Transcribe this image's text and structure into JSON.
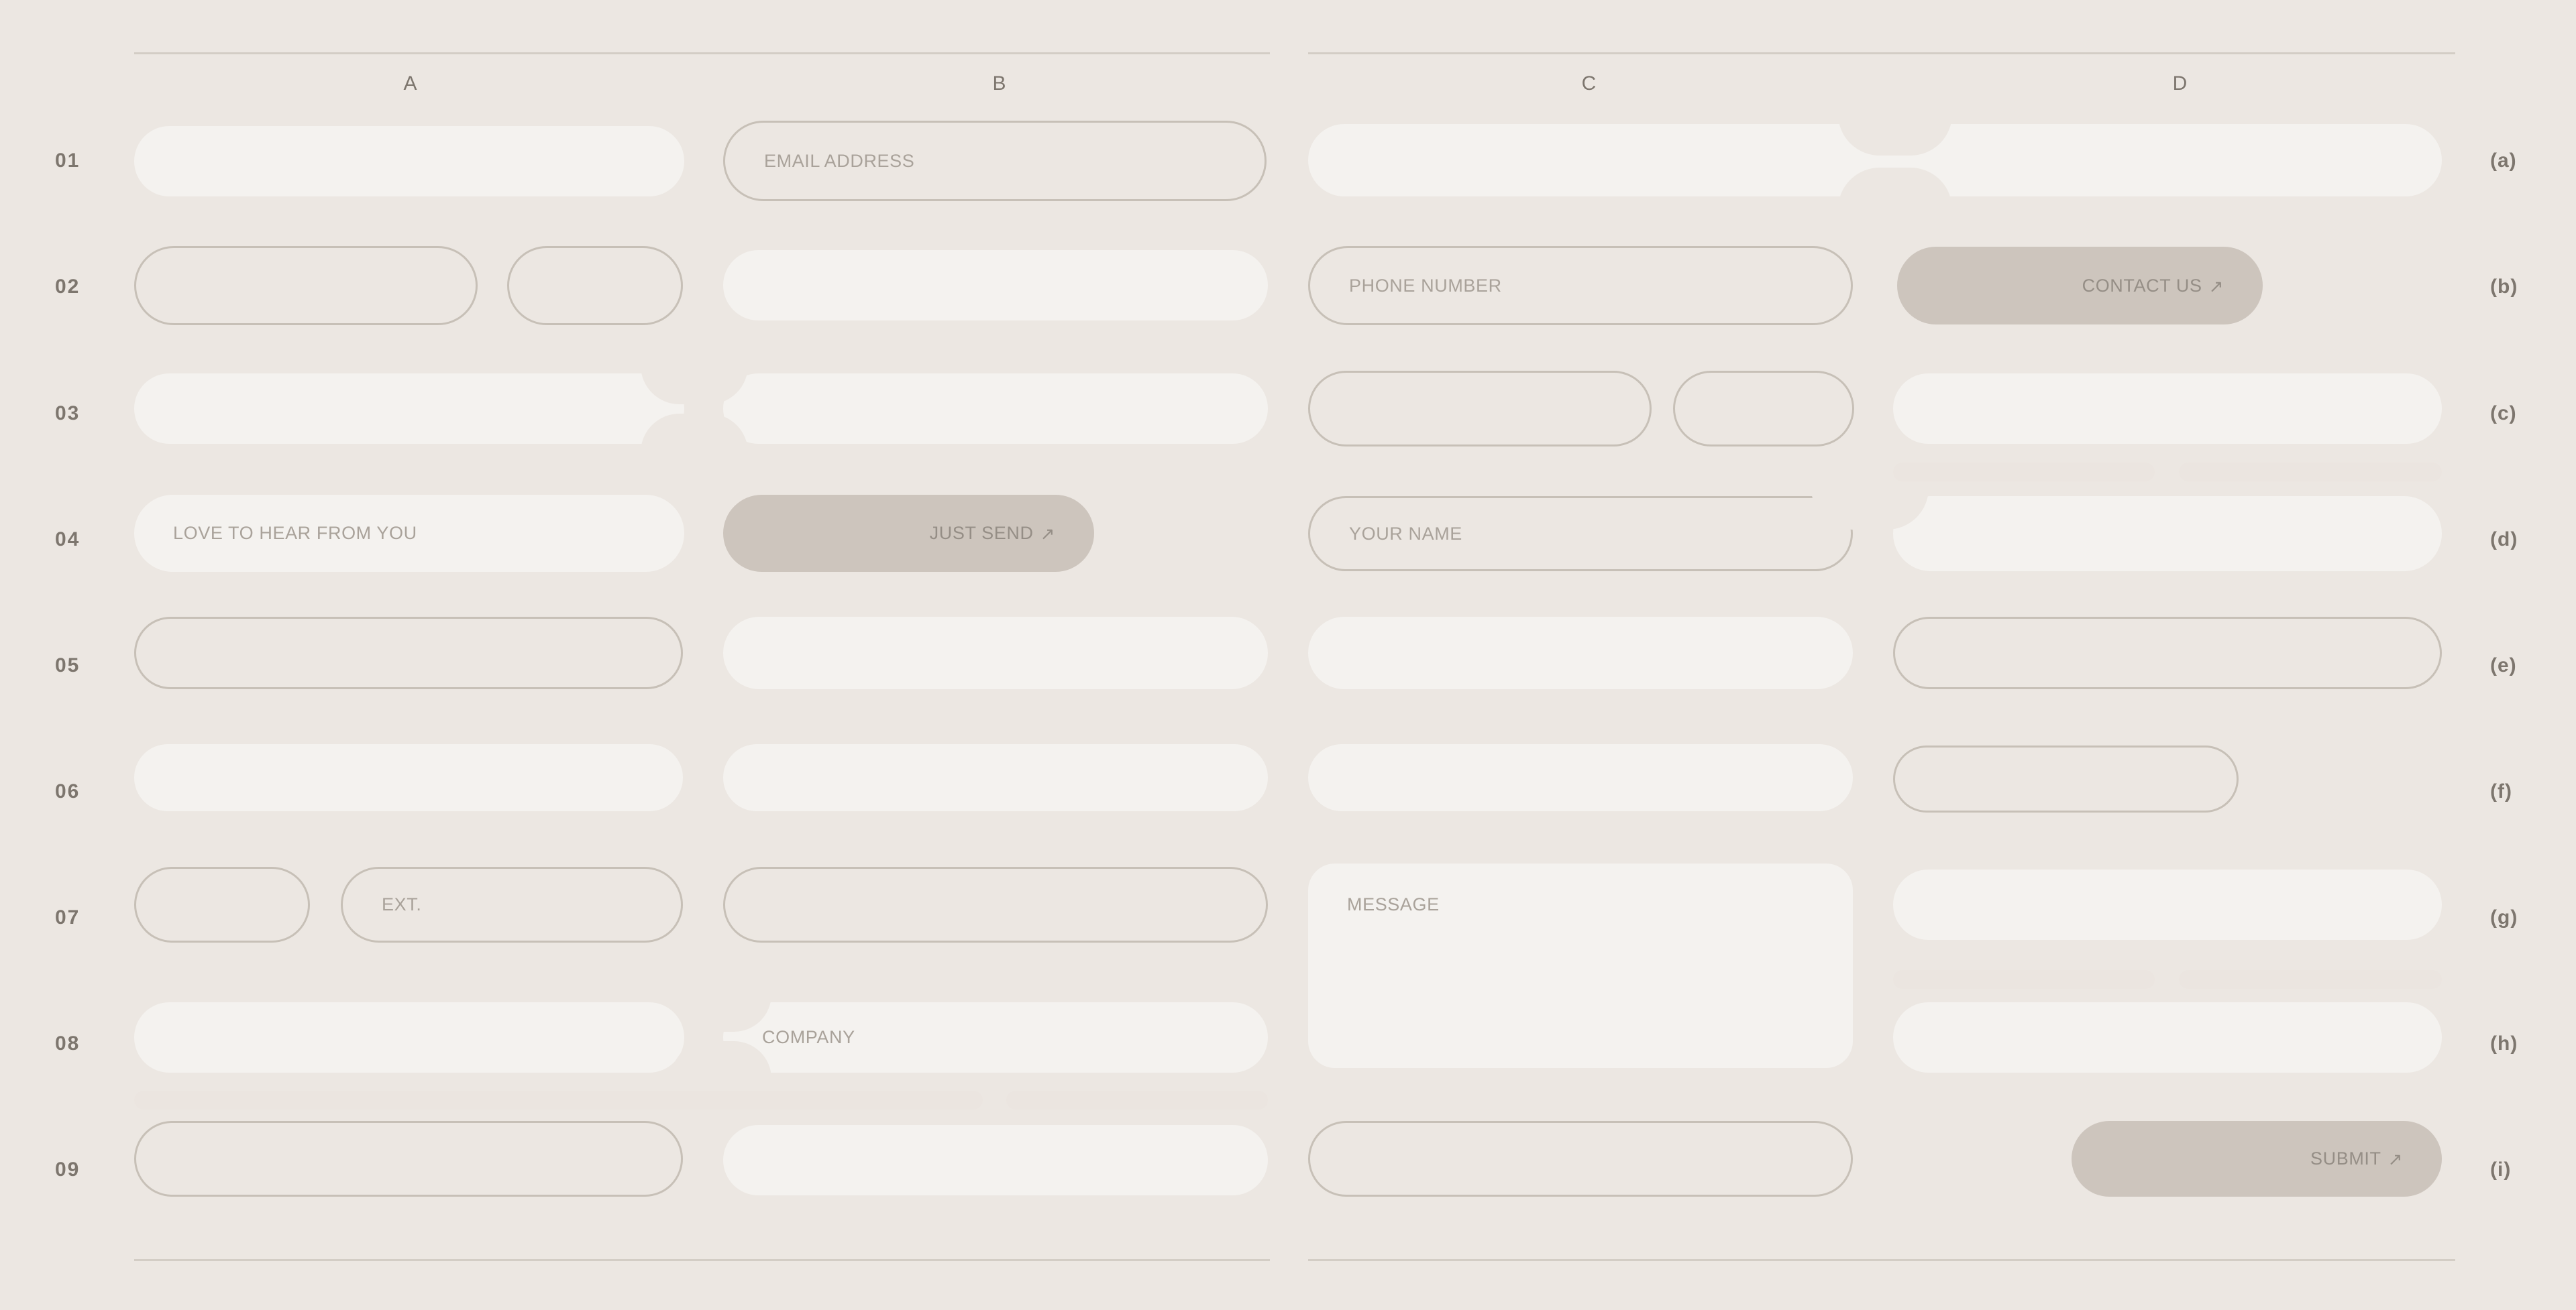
{
  "grid": {
    "columns": [
      "A",
      "B",
      "C",
      "D"
    ],
    "rows_left": [
      "01",
      "02",
      "03",
      "04",
      "05",
      "06",
      "07",
      "08",
      "09"
    ],
    "rows_right": [
      "(a)",
      "(b)",
      "(c)",
      "(d)",
      "(e)",
      "(f)",
      "(g)",
      "(h)",
      "(i)"
    ]
  },
  "colors": {
    "background": "#ece7e2",
    "field_solid": "#f4f2ef",
    "field_bar": "#ebe5e0",
    "field_outline_border": "#c7c0b7",
    "button_fill": "#cdc5bd",
    "label_text": "#a9a29a",
    "axis_text": "#7d766e",
    "rule": "#d3cdc5"
  },
  "fields": {
    "email_address": {
      "placeholder": "EMAIL ADDRESS"
    },
    "phone_number": {
      "placeholder": "PHONE NUMBER"
    },
    "your_name": {
      "placeholder": "YOUR NAME"
    },
    "love_to_hear": {
      "placeholder": "LOVE TO HEAR FROM YOU"
    },
    "extension": {
      "placeholder": "EXT."
    },
    "company": {
      "placeholder": "COMPANY"
    },
    "message": {
      "placeholder": "MESSAGE"
    }
  },
  "buttons": {
    "contact_us": {
      "label": "CONTACT US",
      "icon": "arrow-up-right-icon",
      "glyph": "↗"
    },
    "just_send": {
      "label": "JUST SEND",
      "icon": "arrow-up-right-icon",
      "glyph": "↗"
    },
    "submit": {
      "label": "SUBMIT",
      "icon": "arrow-up-right-icon",
      "glyph": "↗"
    }
  }
}
